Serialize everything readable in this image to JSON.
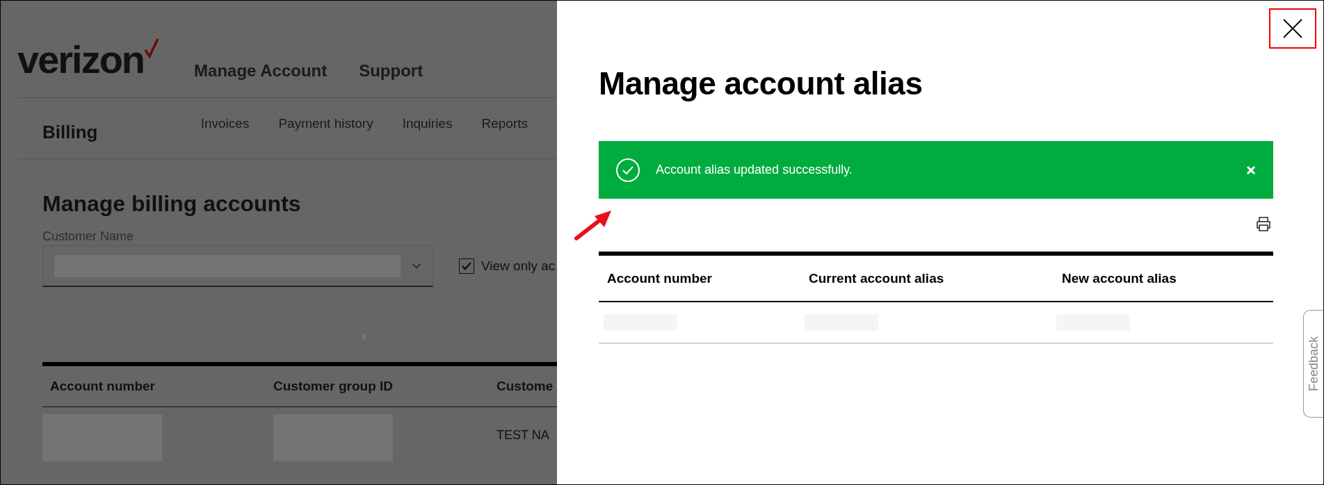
{
  "background_page": {
    "logo": "verizon",
    "nav": [
      "Manage Account",
      "Support"
    ],
    "section_title": "Billing",
    "subnav": [
      "Invoices",
      "Payment history",
      "Inquiries",
      "Reports"
    ],
    "page_title": "Manage billing accounts",
    "customer_field": {
      "label": "Customer Name",
      "redacted": true
    },
    "filter_checkbox": {
      "label": "View only ac",
      "checked": true
    },
    "table": {
      "columns": [
        "Account number",
        "Customer group ID",
        "Custome"
      ],
      "rows": [
        {
          "cells": [
            {
              "redacted": true
            },
            {
              "redacted": true
            },
            {
              "redacted": false,
              "text": "TEST NA"
            }
          ]
        }
      ]
    }
  },
  "modal": {
    "title": "Manage account alias",
    "alert": {
      "message": "Account alias updated successfully."
    },
    "table": {
      "columns": [
        "Account number",
        "Current account alias",
        "New account alias"
      ],
      "rows": [
        {
          "cells": [
            {
              "redacted": true
            },
            {
              "redacted": true
            },
            {
              "redacted": true
            }
          ]
        }
      ]
    }
  },
  "feedback_tab": "Feedback"
}
